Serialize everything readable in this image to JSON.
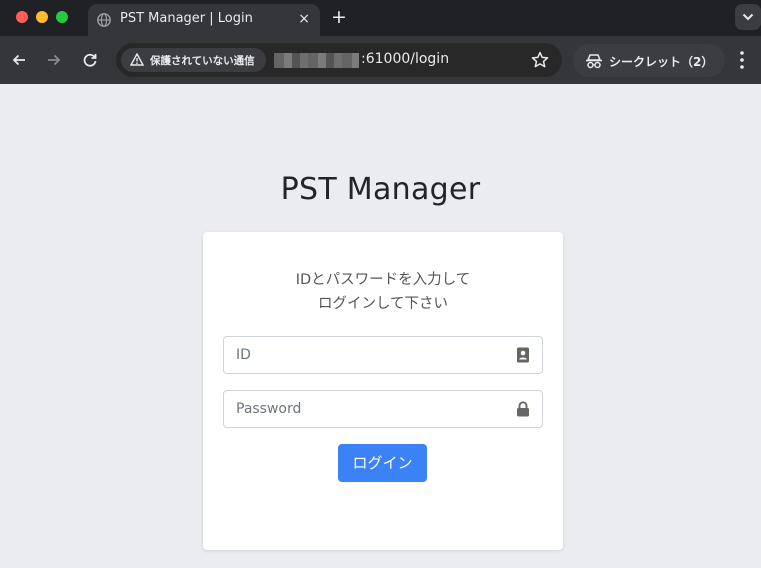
{
  "browser": {
    "tab_title": "PST Manager | Login",
    "tab_close": "×",
    "new_tab": "+",
    "security_label": "保護されていない通信",
    "url": ":61000/login",
    "incognito_label": "シークレット（2）"
  },
  "page": {
    "title": "PST Manager",
    "instruction_line1": "IDとパスワードを入力して",
    "instruction_line2": "ログインして下さい",
    "id_placeholder": "ID",
    "password_placeholder": "Password",
    "login_button": "ログイン"
  },
  "colors": {
    "page_background": "#eaecef",
    "button": "#3b82f6",
    "chrome_dark": "#202124"
  },
  "icons": {
    "id_field": "contact-card-icon",
    "password_field": "lock-icon"
  }
}
